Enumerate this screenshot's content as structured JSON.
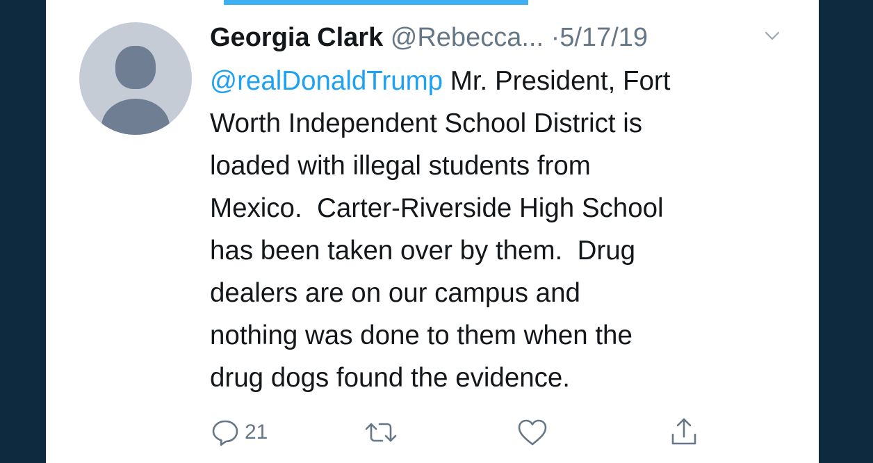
{
  "tweet": {
    "author_name": "Georgia Clark",
    "author_handle": "@Rebecca...",
    "separator": "·",
    "date": "5/17/19",
    "mention": "@realDonaldTrump",
    "lines": [
      " Mr. President, Fort",
      "Worth Independent School District is",
      "loaded with illegal students from",
      "Mexico.  Carter-Riverside High School",
      "has been taken over by them.  Drug",
      "dealers are on our campus and",
      "nothing was done to them when the",
      "drug dogs found the evidence."
    ],
    "reply_count": "21"
  },
  "icons": {
    "reply": "reply-icon",
    "retweet": "retweet-icon",
    "like": "heart-icon",
    "share": "share-icon",
    "menu": "chevron-down-icon"
  },
  "colors": {
    "background": "#0e2a3f",
    "card": "#ffffff",
    "accent": "#1da1f2",
    "text": "#14171a",
    "secondary": "#657786"
  }
}
